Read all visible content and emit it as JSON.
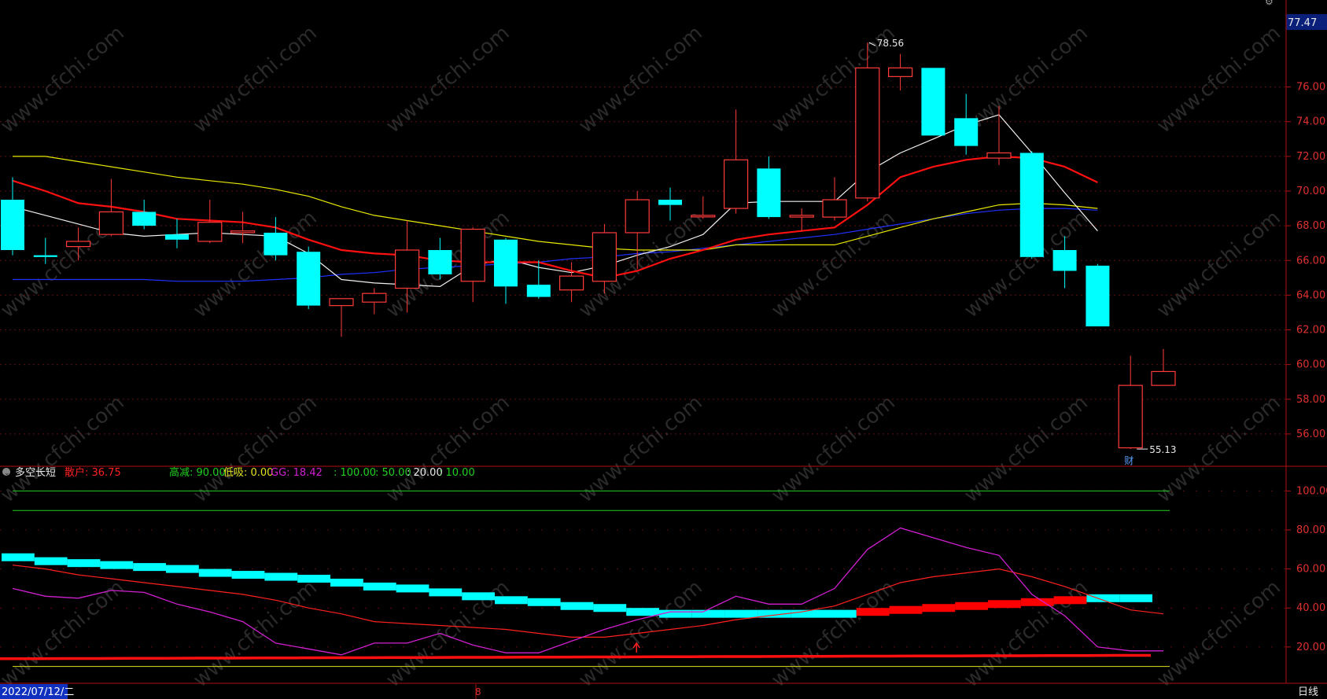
{
  "header": {
    "top_right_price": "77.47"
  },
  "indicator_header": {
    "name": "多空长短",
    "items": [
      {
        "label": "散户: 36.75",
        "color": "#ff2020"
      },
      {
        "label": "高减: 90.00",
        "color": "#20d020"
      },
      {
        "label": "低吸: 0.00",
        "color": "#e0e020"
      },
      {
        "label": "GG: 18.42",
        "color": "#d020d0"
      },
      {
        "label": ": 100.00",
        "color": "#20d020"
      },
      {
        "label": ": 50.00",
        "color": "#20d020"
      },
      {
        "label": ": 20.00",
        "color": "#e8e8e8"
      },
      {
        "label": ": 10.00",
        "color": "#20d020"
      }
    ]
  },
  "annotations": {
    "high_label": "78.56",
    "low_label": "55.13",
    "fin_marker": "财"
  },
  "bottom_bar": {
    "date": "2022/07/12/二",
    "month_marker": "8",
    "period": "日线"
  },
  "watermark": "www.cfchi.com",
  "colors": {
    "up": "#ff3b3b",
    "down": "#00ffff",
    "ma5": "#f0f0f0",
    "ma10": "#ff1010",
    "ma20": "#e8e800",
    "ma60": "#2030ff",
    "axis": "#b01010",
    "grid": "#5a1010",
    "sanhu": "#ff2020",
    "gg": "#d020d0",
    "band": "#00ffff"
  },
  "chart_data": [
    {
      "type": "candlestick",
      "title": "",
      "ylim": [
        54.5,
        79.2
      ],
      "yticks": [
        56,
        58,
        60,
        62,
        64,
        66,
        68,
        70,
        72,
        74,
        76
      ],
      "candles": [
        {
          "o": 69.5,
          "h": 70.8,
          "l": 66.3,
          "c": 66.6
        },
        {
          "o": 66.3,
          "h": 67.3,
          "l": 65.8,
          "c": 66.2
        },
        {
          "o": 66.8,
          "h": 67.9,
          "l": 66.0,
          "c": 67.1
        },
        {
          "o": 67.5,
          "h": 70.7,
          "l": 67.4,
          "c": 68.8
        },
        {
          "o": 68.8,
          "h": 69.5,
          "l": 67.8,
          "c": 68.0
        },
        {
          "o": 67.5,
          "h": 68.4,
          "l": 66.7,
          "c": 67.2
        },
        {
          "o": 67.1,
          "h": 69.5,
          "l": 67.0,
          "c": 68.2
        },
        {
          "o": 67.6,
          "h": 68.8,
          "l": 67.0,
          "c": 67.7
        },
        {
          "o": 67.6,
          "h": 68.5,
          "l": 66.0,
          "c": 66.3
        },
        {
          "o": 66.5,
          "h": 66.8,
          "l": 63.2,
          "c": 63.4
        },
        {
          "o": 63.4,
          "h": 63.8,
          "l": 61.6,
          "c": 63.8
        },
        {
          "o": 63.6,
          "h": 64.4,
          "l": 62.9,
          "c": 64.1
        },
        {
          "o": 64.4,
          "h": 68.3,
          "l": 63.0,
          "c": 66.6
        },
        {
          "o": 66.6,
          "h": 67.3,
          "l": 64.9,
          "c": 65.2
        },
        {
          "o": 64.8,
          "h": 67.9,
          "l": 63.6,
          "c": 67.8
        },
        {
          "o": 67.2,
          "h": 67.3,
          "l": 63.5,
          "c": 64.5
        },
        {
          "o": 64.6,
          "h": 66.0,
          "l": 63.8,
          "c": 63.9
        },
        {
          "o": 64.3,
          "h": 65.9,
          "l": 63.6,
          "c": 65.1
        },
        {
          "o": 64.8,
          "h": 68.1,
          "l": 64.1,
          "c": 67.6
        },
        {
          "o": 67.6,
          "h": 70.0,
          "l": 65.5,
          "c": 69.5
        },
        {
          "o": 69.5,
          "h": 70.2,
          "l": 68.3,
          "c": 69.2
        },
        {
          "o": 68.6,
          "h": 69.7,
          "l": 68.4,
          "c": 68.6
        },
        {
          "o": 69.0,
          "h": 74.7,
          "l": 68.7,
          "c": 71.8
        },
        {
          "o": 71.3,
          "h": 72.0,
          "l": 68.4,
          "c": 68.5
        },
        {
          "o": 68.5,
          "h": 69.0,
          "l": 67.7,
          "c": 68.6
        },
        {
          "o": 68.5,
          "h": 70.8,
          "l": 68.3,
          "c": 69.5
        },
        {
          "o": 69.6,
          "h": 78.56,
          "l": 69.4,
          "c": 77.1
        },
        {
          "o": 76.6,
          "h": 77.9,
          "l": 75.8,
          "c": 77.1
        },
        {
          "o": 77.1,
          "h": 77.1,
          "l": 73.2,
          "c": 73.2
        },
        {
          "o": 74.2,
          "h": 75.6,
          "l": 72.1,
          "c": 72.6
        },
        {
          "o": 71.9,
          "h": 74.9,
          "l": 71.5,
          "c": 72.2
        },
        {
          "o": 72.2,
          "h": 72.3,
          "l": 66.1,
          "c": 66.2
        },
        {
          "o": 66.6,
          "h": 67.4,
          "l": 64.4,
          "c": 65.4
        },
        {
          "o": 65.7,
          "h": 65.8,
          "l": 62.2,
          "c": 62.2
        },
        {
          "o": 55.2,
          "h": 60.5,
          "l": 55.13,
          "c": 58.8
        },
        {
          "o": 58.8,
          "h": 60.9,
          "l": 58.8,
          "c": 59.6
        }
      ],
      "ma5": [
        69.1,
        68.6,
        68.1,
        67.6,
        67.4,
        67.5,
        67.6,
        67.5,
        67.4,
        66.4,
        64.9,
        64.7,
        64.6,
        64.5,
        65.7,
        66.1,
        65.6,
        65.3,
        65.7,
        66.3,
        66.8,
        67.5,
        69.3,
        69.4,
        69.4,
        69.4,
        71.1,
        72.2,
        73.0,
        73.8,
        74.4,
        72.2,
        69.9,
        67.7
      ],
      "ma10": [
        70.6,
        70.0,
        69.3,
        69.1,
        68.8,
        68.4,
        68.3,
        68.2,
        67.9,
        67.2,
        66.6,
        66.4,
        66.3,
        66.0,
        65.9,
        65.9,
        65.9,
        65.4,
        65.0,
        65.4,
        66.1,
        66.6,
        67.2,
        67.5,
        67.7,
        67.9,
        69.2,
        70.8,
        71.4,
        71.8,
        72.0,
        71.9,
        71.4,
        70.5
      ],
      "ma20": [
        72.0,
        72.0,
        71.7,
        71.4,
        71.1,
        70.8,
        70.6,
        70.4,
        70.1,
        69.7,
        69.1,
        68.6,
        68.3,
        68.0,
        67.7,
        67.4,
        67.1,
        66.9,
        66.7,
        66.6,
        66.6,
        66.6,
        66.9,
        66.9,
        66.9,
        66.9,
        67.4,
        67.9,
        68.4,
        68.8,
        69.2,
        69.3,
        69.2,
        69.0
      ],
      "ma60": [
        64.9,
        64.9,
        64.9,
        64.9,
        64.9,
        64.8,
        64.8,
        64.8,
        64.9,
        65.0,
        65.2,
        65.3,
        65.5,
        65.6,
        65.7,
        65.8,
        65.9,
        66.1,
        66.2,
        66.4,
        66.5,
        66.7,
        66.9,
        67.1,
        67.3,
        67.5,
        67.8,
        68.1,
        68.4,
        68.7,
        68.9,
        69.0,
        69.0,
        68.9
      ]
    },
    {
      "type": "line",
      "title": "多空长短",
      "ylim": [
        3,
        105
      ],
      "yticks": [
        20,
        40,
        60,
        80,
        100
      ],
      "hlines": [
        {
          "value": 100,
          "color": "#20d020"
        },
        {
          "value": 90,
          "color": "#20d020"
        },
        {
          "value": 10,
          "color": "#e0e020"
        }
      ],
      "series": [
        {
          "name": "散户",
          "values": [
            62,
            60,
            57,
            55,
            53,
            51,
            49,
            47,
            44,
            40,
            37,
            33,
            32,
            31,
            30,
            29,
            27,
            25,
            25,
            27,
            29,
            31,
            34,
            36,
            38,
            41,
            47,
            53,
            56,
            58,
            60,
            56,
            51,
            45,
            39,
            37
          ]
        },
        {
          "name": "GG",
          "values": [
            50,
            46,
            45,
            49,
            48,
            42,
            38,
            33,
            22,
            19,
            16,
            22,
            22,
            27,
            21,
            17,
            17,
            23,
            29,
            34,
            38,
            38,
            46,
            42,
            42,
            50,
            70,
            81,
            76,
            71,
            67,
            47,
            36,
            20,
            18,
            18
          ]
        },
        {
          "name": "band",
          "values": [
            66,
            64,
            63,
            62,
            61,
            60,
            58,
            57,
            56,
            55,
            53,
            51,
            50,
            48,
            46,
            44,
            43,
            41,
            40,
            38,
            37,
            37,
            37,
            37,
            37,
            37,
            38,
            39,
            40,
            41,
            42,
            43,
            44,
            45,
            45,
            45
          ]
        },
        {
          "name": "base",
          "values": [
            14.0,
            14.0,
            14.1,
            14.1,
            14.2,
            14.2,
            14.3,
            14.3,
            14.4,
            14.4,
            14.5,
            14.5,
            14.6,
            14.6,
            14.7,
            14.7,
            14.8,
            14.8,
            14.9,
            14.9,
            15.0,
            15.0,
            15.1,
            15.1,
            15.2,
            15.2,
            15.3,
            15.3,
            15.4,
            15.4,
            15.5,
            15.5,
            15.6,
            15.6,
            15.7,
            15.7
          ]
        }
      ]
    }
  ]
}
